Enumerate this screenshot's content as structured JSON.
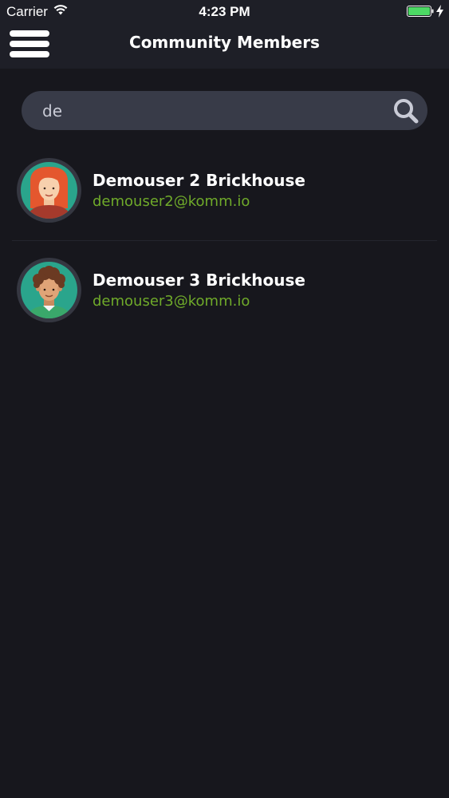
{
  "status_bar": {
    "carrier": "Carrier",
    "time": "4:23 PM",
    "wifi_icon": "wifi-icon",
    "battery_icon": "battery-icon",
    "battery_color": "#4cd964"
  },
  "nav": {
    "title": "Community Members",
    "menu_icon": "hamburger-menu-icon"
  },
  "search": {
    "value": "de",
    "placeholder": "",
    "icon": "search-icon"
  },
  "members": [
    {
      "name": "Demouser 2 Brickhouse",
      "email": "demouser2@komm.io",
      "avatar": "avatar-red-hair"
    },
    {
      "name": "Demouser 3 Brickhouse",
      "email": "demouser3@komm.io",
      "avatar": "avatar-brown-curly-hair"
    }
  ],
  "colors": {
    "background": "#17171d",
    "header": "#1e1f27",
    "search_field": "#383b48",
    "email": "#6faa2a"
  }
}
